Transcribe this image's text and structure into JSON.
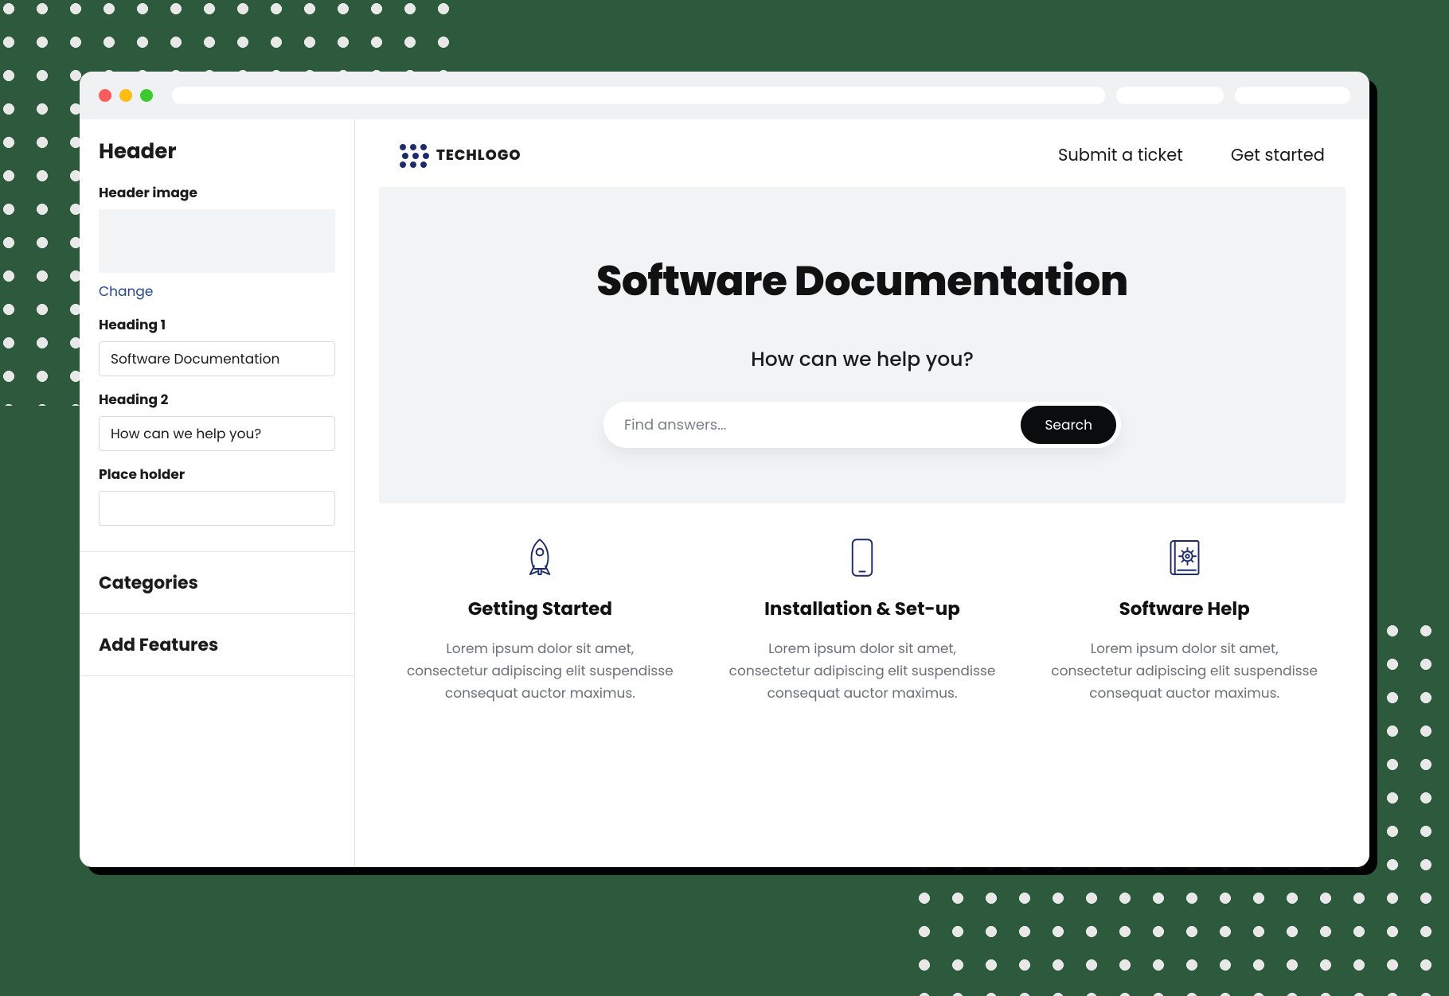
{
  "sidebar": {
    "title": "Header",
    "header_image_label": "Header image",
    "change_label": "Change",
    "heading1_label": "Heading 1",
    "heading1_value": "Software Documentation",
    "heading2_label": "Heading 2",
    "heading2_value": "How can we help you?",
    "placeholder_label": "Place holder",
    "placeholder_value": "",
    "categories_label": "Categories",
    "add_features_label": "Add Features"
  },
  "nav": {
    "brand_text": "TECHLOGO",
    "links": [
      {
        "label": "Submit a ticket"
      },
      {
        "label": "Get started"
      }
    ]
  },
  "hero": {
    "heading1": "Software Documentation",
    "heading2": "How can we help you?",
    "search_placeholder": "Find answers...",
    "search_button": "Search"
  },
  "cards": [
    {
      "title": "Getting Started",
      "body": "Lorem ipsum dolor sit amet, consectetur adipiscing elit suspendisse consequat auctor maximus."
    },
    {
      "title": "Installation & Set-up",
      "body": "Lorem ipsum dolor sit amet, consectetur adipiscing elit suspendisse consequat auctor maximus."
    },
    {
      "title": "Software Help",
      "body": "Lorem ipsum dolor sit amet, consectetur adipiscing elit suspendisse consequat auctor maximus."
    }
  ]
}
